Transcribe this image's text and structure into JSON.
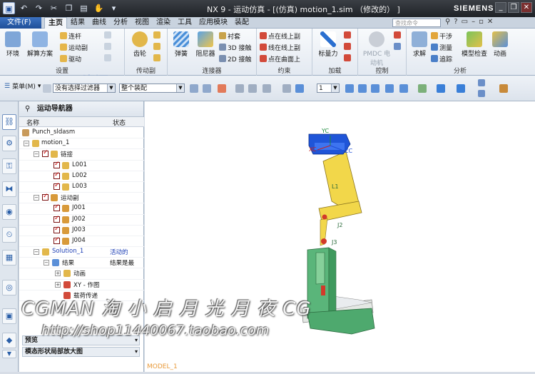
{
  "window": {
    "title": "NX 9 - 运动仿真 - [(仿真) motion_1.sim （修改的） ]",
    "brand": "SIEMENS"
  },
  "menu": {
    "file": "文件(F)",
    "tabs": [
      "主页",
      "结果",
      "曲线",
      "分析",
      "视图",
      "渲染",
      "工具",
      "应用模块",
      "装配"
    ],
    "search_placeholder": "查找命令"
  },
  "ribbon": {
    "groups": {
      "settings": "设置",
      "drivers": "传动副",
      "connectors": "连接器",
      "constraints": "约束",
      "loads": "加载",
      "control": "控制",
      "analysis": "分析"
    },
    "environment": "环境",
    "solution": "解算方案",
    "link": "连杆",
    "joint": "运动副",
    "driver": "驱动",
    "gear": "齿轮",
    "spring": "弹簧",
    "damper": "阻尼器",
    "bushing": "衬套",
    "contact3d": "3D 接触",
    "contact2d": "2D 接触",
    "pt_on_curve": "点在线上副",
    "curve_on_curve": "线在线上副",
    "pt_on_surface": "点在曲面上",
    "scalar_force": "标量力",
    "pmdc": "PMDC 电动机",
    "solve": "求解",
    "interference": "干涉",
    "measure": "测量",
    "trace": "追踪",
    "check": "模型检查",
    "animation": "动画"
  },
  "toolbar": {
    "menu": "菜单(M)",
    "filter": "没有选择过滤器",
    "assembly": "整个装配",
    "layer": "1"
  },
  "navigator": {
    "title": "运动导航器",
    "col_name": "名称",
    "col_status": "状态",
    "rows": [
      {
        "label": "Punch_sldasm",
        "status": ""
      },
      {
        "label": "motion_1",
        "status": ""
      },
      {
        "label": "链接",
        "status": ""
      },
      {
        "label": "L001",
        "status": ""
      },
      {
        "label": "L002",
        "status": ""
      },
      {
        "label": "L003",
        "status": ""
      },
      {
        "label": "运动副",
        "status": ""
      },
      {
        "label": "J001",
        "status": ""
      },
      {
        "label": "J002",
        "status": ""
      },
      {
        "label": "J003",
        "status": ""
      },
      {
        "label": "J004",
        "status": ""
      },
      {
        "label": "Solution_1",
        "status": "活动的"
      },
      {
        "label": "结果",
        "status": "结果是最"
      },
      {
        "label": "动画",
        "status": ""
      },
      {
        "label": "XY - 作图",
        "status": ""
      },
      {
        "label": "载荷传递",
        "status": ""
      }
    ],
    "preview": "预览",
    "depends": "模态形状局部放大图"
  },
  "viewport": {
    "model_name": "MODEL_1",
    "labels": {
      "yc": "YC",
      "xc": "XC",
      "zc": "ZC",
      "l1": "L1",
      "j2": "J2",
      "j3": "J3"
    }
  },
  "watermark": {
    "line1": "CGMAN 淘 小 启 月 光 月 夜 CG",
    "line2": "http://shop11440067.taobao.com",
    "logo": "RBCG资源"
  },
  "colors": {
    "accent": "#1f4f98",
    "mechanism_yellow": "#f2d74a",
    "base_green": "#5ab57a",
    "joint_red": "#d23a2a",
    "axis_blue": "#1f55d8"
  }
}
